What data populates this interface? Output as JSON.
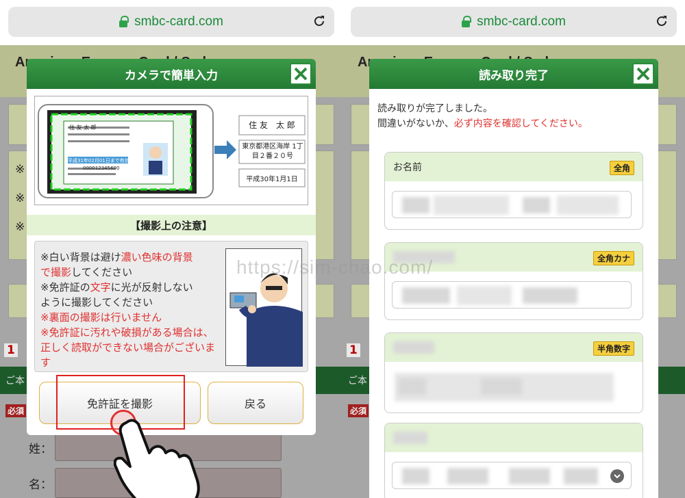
{
  "left": {
    "url": "smbc-card.com",
    "bg_title": "American Express Card / Smbc",
    "bg_rows": [
      "※",
      "※",
      "※"
    ],
    "bg_step": "1",
    "bg_notice": "ご本",
    "bg_required": "必須",
    "bg_last_label": "姓：",
    "bg_first_label": "名：",
    "modal": {
      "title": "カメラで簡単入力",
      "illus_name": "住 友　太 郎",
      "illus_address": "東京都港区海岸 1丁目２番２０号",
      "illus_date": "平成30年1月1日",
      "card_name": "住 友 太 郎",
      "card_expiry": "平成31年02月01日まで有効",
      "card_number": "000012345600",
      "notes_heading": "【撮影上の注意】",
      "note1_a": "※白い背景は避け",
      "note1_b": "濃い色味の背景",
      "note1_c": "で撮影",
      "note1_d": "してください",
      "note2_a": "※免許証の",
      "note2_b": "文字",
      "note2_c": "に光が反射しない",
      "note2_d": "ように撮影してください",
      "note3": "※裏面の撮影は行いません",
      "note4": "※免許証に汚れや破損がある場合は、正しく読取ができない場合がございます",
      "primary_button": "免許証を撮影",
      "secondary_button": "戻る"
    }
  },
  "right": {
    "url": "smbc-card.com",
    "modal": {
      "title": "読み取り完了",
      "message_line1": "読み取りが完了しました。",
      "message_line2_a": "間違いがないか、",
      "message_line2_b": "必ず内容を確認してください。",
      "fields": [
        {
          "label": "お名前",
          "badge": "全角"
        },
        {
          "label": "",
          "badge": "全角カナ"
        },
        {
          "label": "",
          "badge": "半角数字"
        },
        {
          "label": "",
          "badge": ""
        }
      ]
    }
  },
  "watermark": "https://sim-chao.com/",
  "colors": {
    "header_green": "#2d8a3c",
    "accent_red": "#e03030",
    "badge_yellow": "#f5cf3d",
    "url_green": "#1a8a3a"
  }
}
